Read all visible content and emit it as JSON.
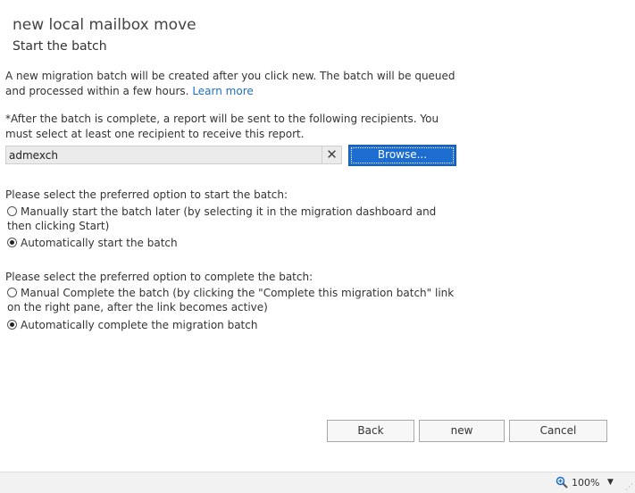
{
  "header": {
    "title": "new local mailbox move",
    "subtitle": "Start the batch"
  },
  "intro": {
    "text": "A new migration batch will be created after you click new. The batch will be queued and processed within a few hours.",
    "link": "Learn more"
  },
  "recipients": {
    "note": "*After the batch is complete, a report will be sent to the following recipients. You must select at least one recipient to receive this report.",
    "value": "admexch",
    "clear_glyph": "✕",
    "browse_label": "Browse..."
  },
  "start_options": {
    "prompt": "Please select the preferred option to start the batch:",
    "manual": "Manually start the batch later (by selecting it in the migration dashboard and then clicking Start)",
    "auto": "Automatically start the batch",
    "selected": "auto"
  },
  "complete_options": {
    "prompt": "Please select the preferred option to complete the batch:",
    "manual": "Manual Complete the batch (by clicking the \"Complete this migration batch\" link on the right pane, after the link becomes active)",
    "auto": "Automatically complete the migration batch",
    "selected": "auto"
  },
  "footer": {
    "back": "Back",
    "new": "new",
    "cancel": "Cancel"
  },
  "statusbar": {
    "zoom": "100%",
    "zoom_caret": "▼",
    "zoom_icon": "magnifier-plus-icon"
  },
  "colors": {
    "accent": "#1d6ccf",
    "link": "#1e6fc2"
  }
}
